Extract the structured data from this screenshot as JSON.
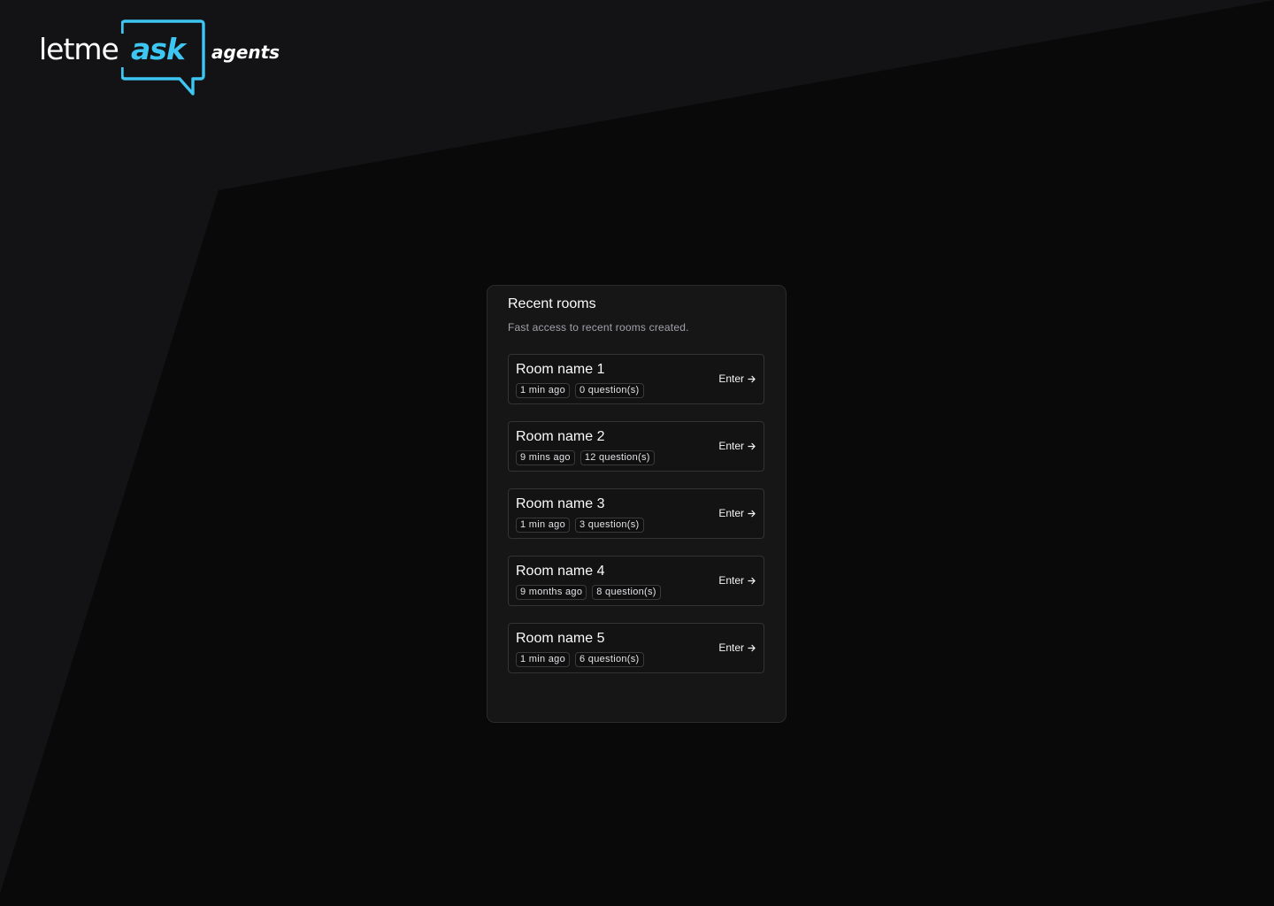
{
  "brand": {
    "letme": "letme",
    "ask": "ask",
    "agents": "agents",
    "accent": "#3ec6f2"
  },
  "recent_rooms": {
    "title": "Recent rooms",
    "subtitle": "Fast access to recent rooms created.",
    "enter_label": "Enter",
    "rooms": [
      {
        "name": "Room name 1",
        "time": "1 min ago",
        "questions": "0 question(s)"
      },
      {
        "name": "Room name 2",
        "time": "9 mins ago",
        "questions": "12 question(s)"
      },
      {
        "name": "Room name 3",
        "time": "1 min ago",
        "questions": "3 question(s)"
      },
      {
        "name": "Room name 4",
        "time": "9 months ago",
        "questions": "8 question(s)"
      },
      {
        "name": "Room name 5",
        "time": "1 min ago",
        "questions": "6 question(s)"
      }
    ]
  },
  "icons": {
    "logo_bubble": "speech-bubble-icon",
    "enter_arrow": "arrow-right-icon"
  }
}
